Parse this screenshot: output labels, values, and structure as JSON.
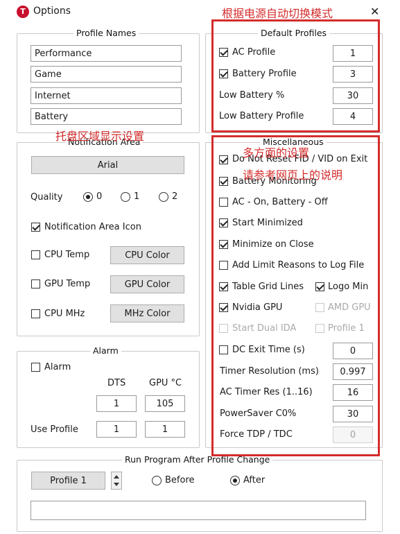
{
  "window": {
    "title": "Options",
    "close_glyph": "✕"
  },
  "annotations": {
    "auto_switch": "根据电源自动切换模式",
    "tray_display": "托盘区域显示设置",
    "misc_settings": "多方面的设置",
    "see_web": "请参考网页上的说明",
    "color": "#d42c2c"
  },
  "profile_names": {
    "legend": "Profile Names",
    "names": [
      "Performance",
      "Game",
      "Internet",
      "Battery"
    ]
  },
  "default_profiles": {
    "legend": "Default Profiles",
    "ac_profile_label": "AC Profile",
    "ac_profile_value": "1",
    "battery_profile_label": "Battery Profile",
    "battery_profile_value": "3",
    "low_battery_pct_label": "Low Battery %",
    "low_battery_pct_value": "30",
    "low_battery_profile_label": "Low Battery Profile",
    "low_battery_profile_value": "4"
  },
  "notification_area": {
    "legend": "Notification Area",
    "font_button": "Arial",
    "quality_label": "Quality",
    "quality_options": [
      "0",
      "1",
      "2"
    ],
    "quality_selected": "0",
    "icon_label": "Notification Area Icon",
    "cpu_temp_label": "CPU Temp",
    "cpu_color_button": "CPU Color",
    "gpu_temp_label": "GPU Temp",
    "gpu_color_button": "GPU Color",
    "cpu_mhz_label": "CPU MHz",
    "mhz_color_button": "MHz Color"
  },
  "alarm": {
    "legend": "Alarm",
    "alarm_label": "Alarm",
    "dts_header": "DTS",
    "gpu_header": "GPU °C",
    "dts_value": "1",
    "gpu_value": "105",
    "use_profile_label": "Use Profile",
    "use_profile_dts": "1",
    "use_profile_gpu": "1"
  },
  "misc": {
    "legend": "Miscellaneous",
    "do_not_reset": "Do Not Reset FID / VID on Exit",
    "battery_monitoring": "Battery Monitoring",
    "ac_on_battery_off": "AC - On, Battery - Off",
    "start_minimized": "Start Minimized",
    "minimize_on_close": "Minimize on Close",
    "add_limit_reasons": "Add Limit Reasons to Log File",
    "table_grid_lines": "Table Grid Lines",
    "logo_min": "Logo Min",
    "nvidia_gpu": "Nvidia GPU",
    "amd_gpu": "AMD GPU",
    "start_dual_ida": "Start Dual IDA",
    "profile_1": "Profile 1",
    "dc_exit_time_label": "DC Exit Time (s)",
    "dc_exit_time_value": "0",
    "timer_resolution_label": "Timer Resolution (ms)",
    "timer_resolution_value": "0.997",
    "ac_timer_res_label": "AC Timer Res (1..16)",
    "ac_timer_res_value": "16",
    "powersaver_label": "PowerSaver C0%",
    "powersaver_value": "30",
    "force_tdp_label": "Force TDP / TDC",
    "force_tdp_value": "0"
  },
  "run_program": {
    "legend": "Run Program After Profile Change",
    "profile_button": "Profile 1",
    "before_label": "Before",
    "after_label": "After",
    "selected": "After",
    "path_value": ""
  }
}
